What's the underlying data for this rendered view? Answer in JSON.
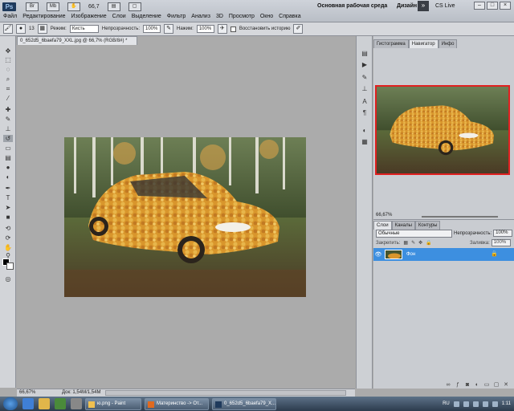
{
  "app": {
    "logo": "Ps"
  },
  "topbar": {
    "zoom": "66,7",
    "workspace": "Основная рабочая среда",
    "design": "Дизайн",
    "cslive": "CS Live"
  },
  "menu": [
    "Файл",
    "Редактирование",
    "Изображение",
    "Слои",
    "Выделение",
    "Фильтр",
    "Анализ",
    "3D",
    "Просмотр",
    "Окно",
    "Справка"
  ],
  "options": {
    "brush_size": "13",
    "mode_label": "Режим:",
    "mode_value": "Кисть",
    "opacity_label": "Непрозрачность:",
    "opacity_value": "100%",
    "pressure_label": "Нажим:",
    "pressure_value": "100%",
    "restore_label": "Восстановить историю"
  },
  "document": {
    "tab_title": "0_652d5_6baefa79_XXL.jpg @ 66,7% (RGB/8#) *",
    "status_zoom": "66,67%",
    "status_doc": "Док: 1,54M/1,54M"
  },
  "navigator": {
    "tabs": [
      "Гистограмма",
      "Навигатор",
      "Инфо"
    ],
    "active_tab": "Навигатор",
    "zoom": "66,67%"
  },
  "layers": {
    "tabs": [
      "Слои",
      "Каналы",
      "Контуры"
    ],
    "active_tab": "Слои",
    "blend_mode": "Обычные",
    "opacity_label": "Непрозрачность:",
    "opacity_value": "100%",
    "lock_label": "Закрепить:",
    "fill_label": "Заливка:",
    "fill_value": "100%",
    "layer_name": "Фон"
  },
  "taskbar": {
    "tasks": [
      "ю.png - Paint",
      "Материнство -> От...",
      "0_652d5_6baefa79_X..."
    ],
    "lang": "RU",
    "time": "1:11"
  },
  "icons": {
    "toolbox": [
      "move-icon",
      "marquee-icon",
      "lasso-icon",
      "quick-select-icon",
      "crop-icon",
      "eyedropper-icon",
      "spot-heal-icon",
      "brush-icon",
      "clone-stamp-icon",
      "history-brush-icon",
      "eraser-icon",
      "gradient-icon",
      "blur-icon",
      "dodge-icon",
      "pen-icon",
      "type-icon",
      "path-select-icon",
      "shape-icon",
      "3d-rotate-icon",
      "3d-orbit-icon",
      "hand-icon",
      "zoom-icon"
    ],
    "active_tool": "history-brush-icon"
  }
}
